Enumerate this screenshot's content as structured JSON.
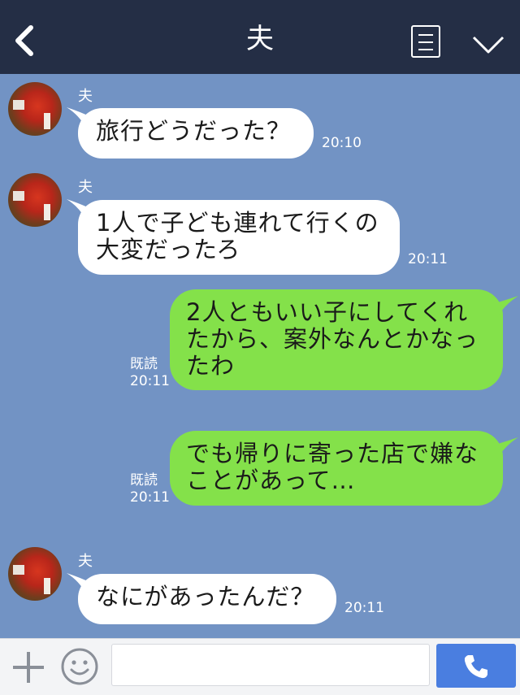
{
  "header": {
    "title": "夫"
  },
  "messages": [
    {
      "sender": "夫",
      "text": "旅行どうだった？",
      "time": "20:10"
    },
    {
      "sender": "夫",
      "text": "1人で子ども連れて行くの\n大変だったろ",
      "time": "20:11"
    },
    {
      "text": "2人ともいい子にしてくれ\nたから、案外なんとかなっ\nたわ",
      "read": "既読",
      "time": "20:11"
    },
    {
      "text": "でも帰りに寄った店で嫌な\nことがあって…",
      "read": "既読",
      "time": "20:11"
    },
    {
      "sender": "夫",
      "text": "なにがあったんだ？",
      "time": "20:11"
    }
  ],
  "input": {
    "value": "",
    "placeholder": ""
  },
  "colors": {
    "background": "#7293c4",
    "header": "#242e45",
    "outgoing": "#84e14a",
    "incoming": "#ffffff",
    "send": "#4a7ee0"
  },
  "icons": [
    "back-icon",
    "menu-icon",
    "chevron-down-icon",
    "plus-icon",
    "smiley-icon",
    "phone-icon"
  ]
}
